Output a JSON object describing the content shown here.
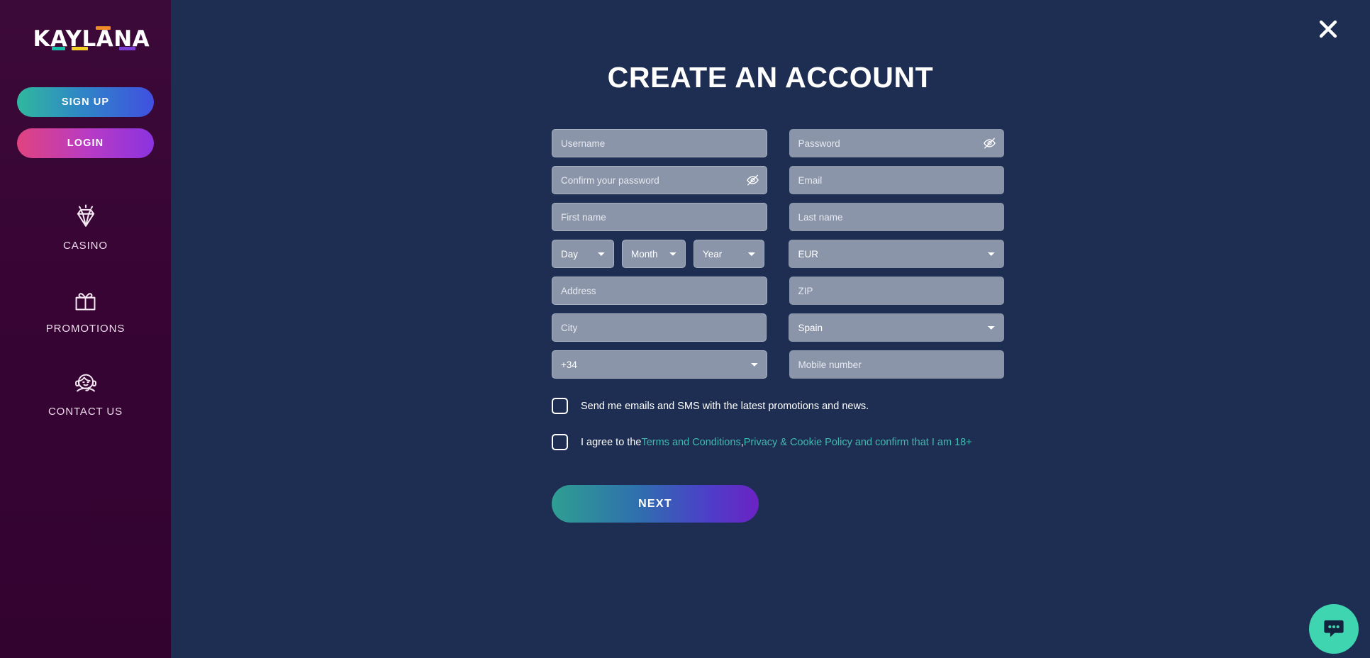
{
  "sidebar": {
    "logo": {
      "text": "KAYLANA",
      "accent_colors": [
        "#16c0a8",
        "#f2d024",
        "#f08a28",
        "#7c3fd4"
      ]
    },
    "signup_label": "SIGN UP",
    "login_label": "LOGIN",
    "nav": [
      {
        "label": "CASINO",
        "icon": "diamond-icon"
      },
      {
        "label": "PROMOTIONS",
        "icon": "gift-icon"
      },
      {
        "label": "CONTACT US",
        "icon": "support-agent-icon"
      }
    ]
  },
  "main": {
    "title": "CREATE AN ACCOUNT",
    "close_icon": "close-icon",
    "form": {
      "username": {
        "placeholder": "Username",
        "value": ""
      },
      "password": {
        "placeholder": "Password",
        "value": "",
        "toggle_icon": "eye-off-icon"
      },
      "confirm_password": {
        "placeholder": "Confirm your password",
        "value": "",
        "toggle_icon": "eye-off-icon"
      },
      "email": {
        "placeholder": "Email",
        "value": ""
      },
      "first_name": {
        "placeholder": "First name",
        "value": ""
      },
      "last_name": {
        "placeholder": "Last name",
        "value": ""
      },
      "dob_day": {
        "selected": "Day",
        "options": [
          "Day"
        ]
      },
      "dob_month": {
        "selected": "Month",
        "options": [
          "Month"
        ]
      },
      "dob_year": {
        "selected": "Year",
        "options": [
          "Year"
        ]
      },
      "currency": {
        "selected": "EUR",
        "options": [
          "EUR"
        ]
      },
      "address": {
        "placeholder": "Address",
        "value": ""
      },
      "zip": {
        "placeholder": "ZIP",
        "value": ""
      },
      "city": {
        "placeholder": "City",
        "value": ""
      },
      "country": {
        "selected": "Spain",
        "options": [
          "Spain"
        ]
      },
      "dial_code": {
        "selected": "+34",
        "options": [
          "+34"
        ]
      },
      "mobile": {
        "placeholder": "Mobile number",
        "value": ""
      }
    },
    "consents": {
      "marketing_label": "Send me emails and SMS with the latest promotions and news.",
      "marketing_checked": false,
      "terms_prefix": "I agree to the",
      "terms_link": "Terms and Conditions",
      "terms_separator": ",",
      "privacy_link": "Privacy & Cookie Policy and confirm that I am 18+",
      "terms_checked": false
    },
    "next_label": "NEXT"
  },
  "chat": {
    "icon": "chat-bubble-icon",
    "color": "#3fd5b0"
  }
}
